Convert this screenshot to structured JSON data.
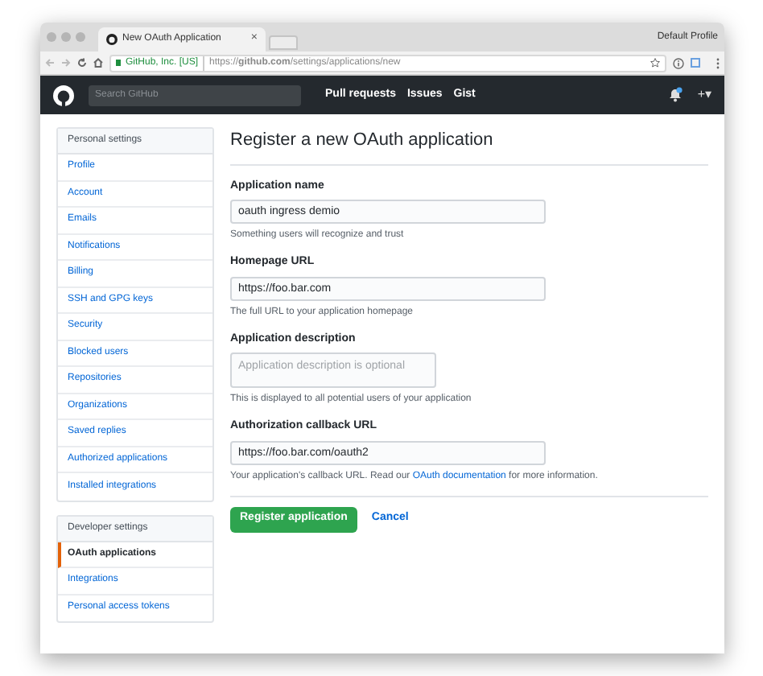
{
  "browser": {
    "tab_title": "New OAuth Application",
    "tab_close": "×",
    "profile": "Default Profile",
    "secure_label": "GitHub, Inc. [US]",
    "url": "https://**github.com**/settings/applications/new"
  },
  "header": {
    "search": {
      "placeholder": "Search GitHub"
    },
    "nav": [
      "Pull requests",
      "Issues",
      "Gist"
    ],
    "add": "+▾"
  },
  "sidebar": [
    {
      "title": "Personal settings",
      "items": [
        {
          "label": "Profile",
          "selected": false
        },
        {
          "label": "Account",
          "selected": false
        },
        {
          "label": "Emails",
          "selected": false
        },
        {
          "label": "Notifications",
          "selected": false
        },
        {
          "label": "Billing",
          "selected": false
        },
        {
          "label": "SSH and GPG keys",
          "selected": false
        },
        {
          "label": "Security",
          "selected": false
        },
        {
          "label": "Blocked users",
          "selected": false
        },
        {
          "label": "Repositories",
          "selected": false
        },
        {
          "label": "Organizations",
          "selected": false
        },
        {
          "label": "Saved replies",
          "selected": false
        },
        {
          "label": "Authorized applications",
          "selected": false
        },
        {
          "label": "Installed integrations",
          "selected": false
        }
      ]
    },
    {
      "title": "Developer settings",
      "items": [
        {
          "label": "OAuth applications",
          "selected": true
        },
        {
          "label": "Integrations",
          "selected": false
        },
        {
          "label": "Personal access tokens",
          "selected": false
        }
      ]
    }
  ],
  "form": {
    "title": "Register a new OAuth application",
    "fields": [
      {
        "kind": "input",
        "label": "Application name",
        "value": "oauth ingress demio",
        "help": "Something users will recognize and trust"
      },
      {
        "kind": "input",
        "label": "Homepage URL",
        "value": "https://foo.bar.com",
        "help": "The full URL to your application homepage"
      },
      {
        "kind": "textarea",
        "label": "Application description",
        "placeholder": "Application description is optional",
        "help": "This is displayed to all potential users of your application"
      },
      {
        "kind": "input",
        "label": "Authorization callback URL",
        "value": "https://foo.bar.com/oauth2",
        "help": "Your application's callback URL. Read our",
        "help_link": "OAuth documentation",
        "help_after": "for more information."
      }
    ],
    "submit": "Register application",
    "cancel": "Cancel"
  }
}
